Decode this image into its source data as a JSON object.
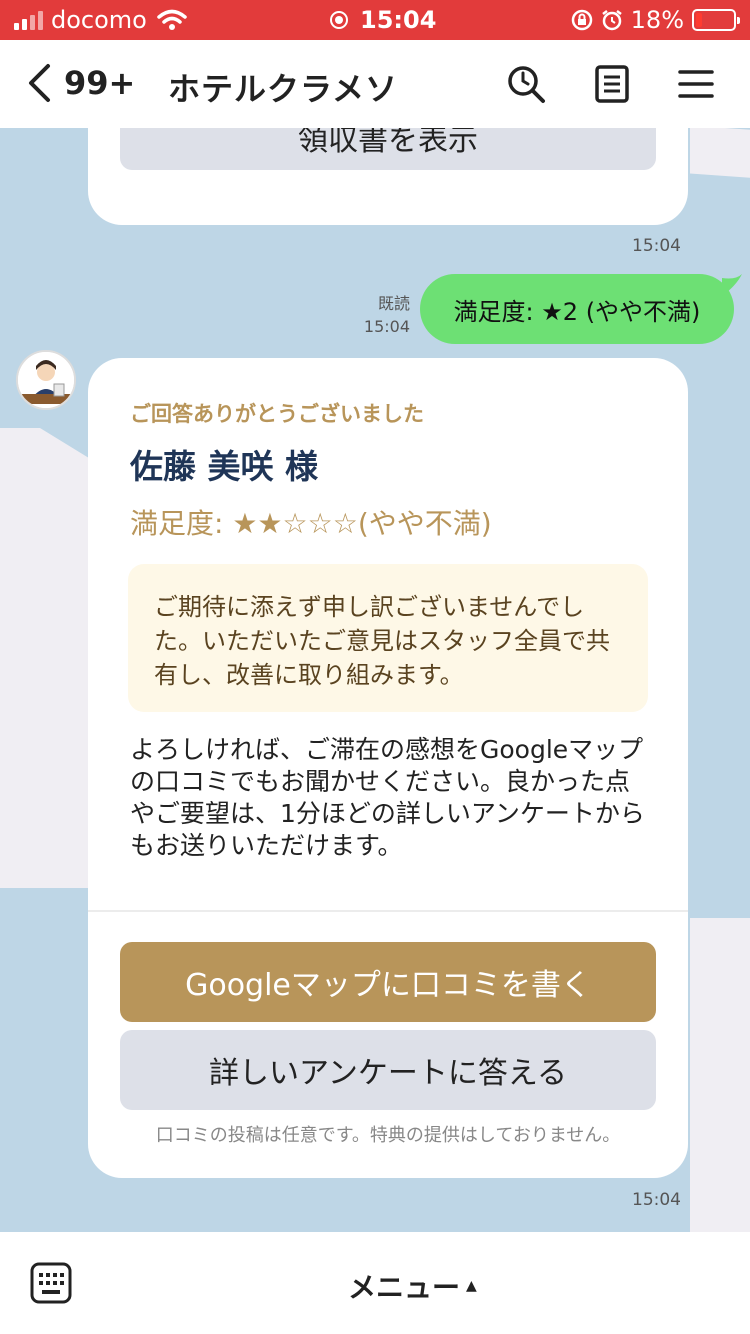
{
  "status_bar": {
    "carrier": "docomo",
    "time": "15:04",
    "battery": "18%",
    "battery_level": 0.18
  },
  "header": {
    "unread_count": "99+",
    "title": "ホテルクラメソ",
    "icons": [
      "back-chevron-icon",
      "search-icon",
      "notes-icon",
      "menu-icon"
    ]
  },
  "messages": {
    "receipt_button": "領収書を表示",
    "receipt_time": "15:04",
    "user_read": "既読",
    "user_time": "15:04",
    "user_message": "満足度: ★2 (やや不満)",
    "bot_caption": "ご回答ありがとうございました",
    "bot_name": "佐藤 美咲 様",
    "bot_rating": "満足度: ★★☆☆☆(やや不満)",
    "bot_apology": "ご期待に添えず申し訳ございませんでした。いただいたご意見はスタッフ全員で共有し、改善に取り組みます。",
    "bot_body": "よろしければ、ご滞在の感想をGoogleマップの口コミでもお聞かせください。良かった点やご要望は、1分ほどの詳しいアンケートからもお送りいただけます。",
    "google_button": "Googleマップに口コミを書く",
    "survey_button": "詳しいアンケートに答える",
    "note": "口コミの投稿は任意です。特典の提供はしておりません。",
    "bot_time": "15:04"
  },
  "bottom_bar": {
    "menu_label": "メニュー",
    "menu_arrow": "▲"
  },
  "colors": {
    "status_bar": "#e23b3b",
    "chat_bg": "#bed6e6",
    "outgoing_bubble": "#6de074",
    "accent_gold": "#b8955a",
    "name_navy": "#1f3557",
    "apology_bg": "#fef8e7"
  }
}
